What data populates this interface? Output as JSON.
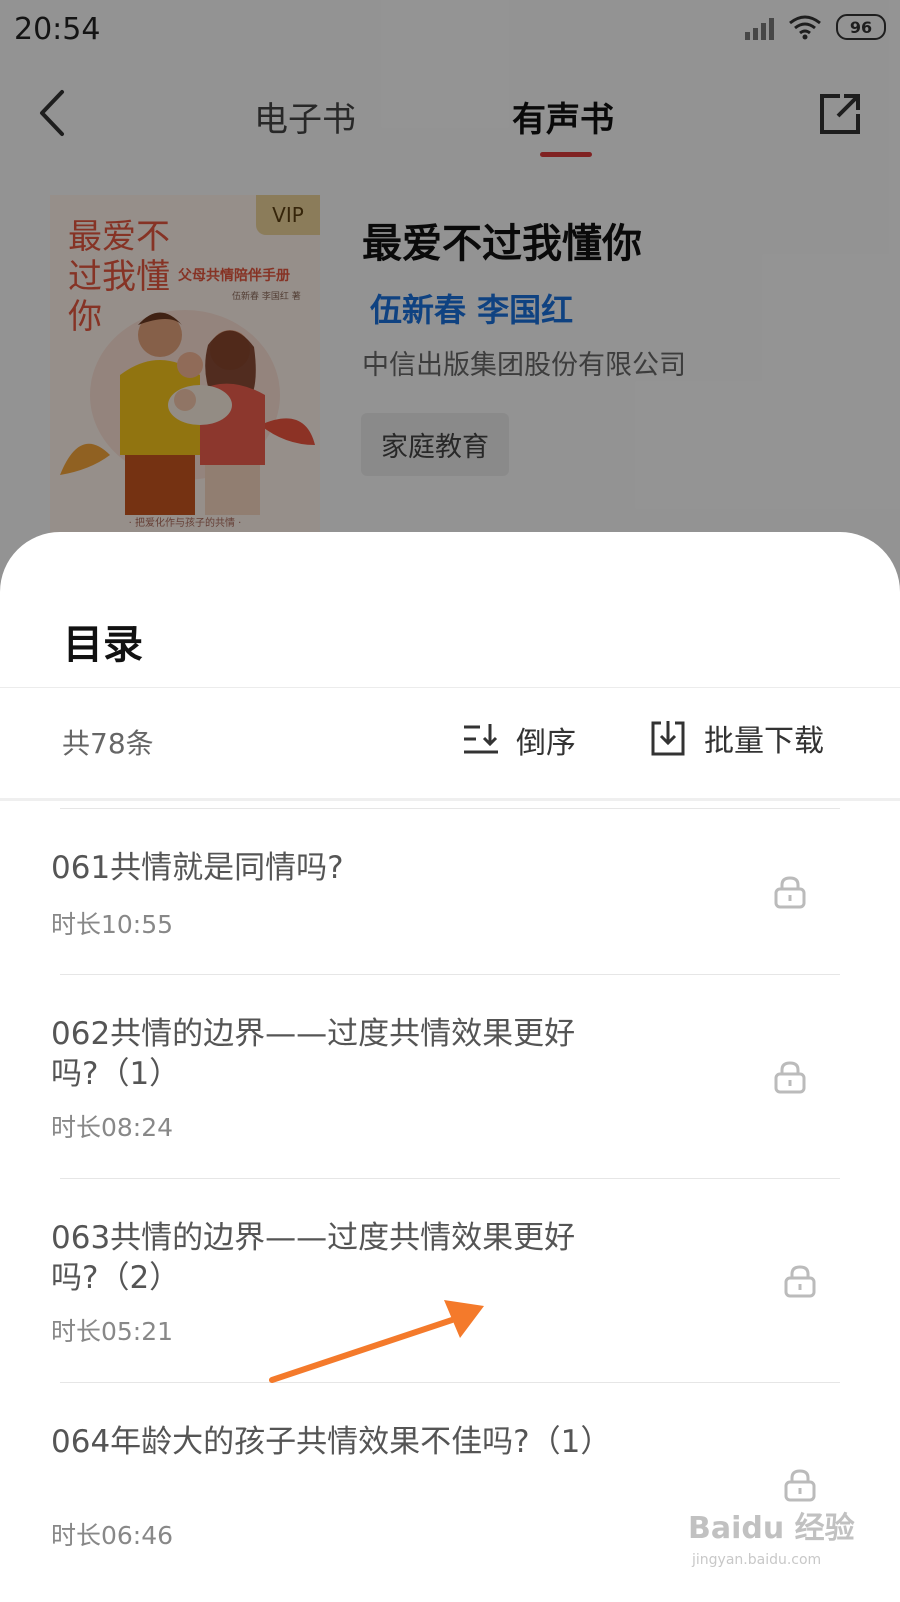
{
  "status_bar": {
    "time": "20:54",
    "battery": "96"
  },
  "nav": {
    "tab_ebook": "电子书",
    "tab_audiobook": "有声书",
    "active_tab": "有声书"
  },
  "book": {
    "cover_title": "最爱不过我懂你",
    "cover_subtitle": "父母共情陪伴手册",
    "cover_authors": "伍新春  李国红 著",
    "cover_tagline": "· 把爱化作与孩子的共情 ·",
    "vip_badge": "VIP",
    "title": "最爱不过我懂你",
    "authors": "伍新春 李国红",
    "publisher": "中信出版集团股份有限公司",
    "category": "家庭教育"
  },
  "catalog": {
    "title": "目录",
    "total": "共78条",
    "sort_label": "倒序",
    "download_label": "批量下载",
    "items": [
      {
        "title": "061共情就是同情吗?",
        "duration": "时长10:55",
        "locked": true
      },
      {
        "title": "062共情的边界——过度共情效果更好吗?（1）",
        "duration": "时长08:24",
        "locked": true
      },
      {
        "title": "063共情的边界——过度共情效果更好吗?（2）",
        "duration": "时长05:21",
        "locked": true
      },
      {
        "title": "064年龄大的孩子共情效果不佳吗?（1）",
        "duration": "时长06:46",
        "locked": true
      }
    ]
  },
  "watermark": {
    "brand": "Baidu 经验",
    "url": "jingyan.baidu.com"
  },
  "colors": {
    "accent": "#d63a3a",
    "author_link": "#1a6ed8",
    "annotation_arrow": "#f47a2b"
  }
}
